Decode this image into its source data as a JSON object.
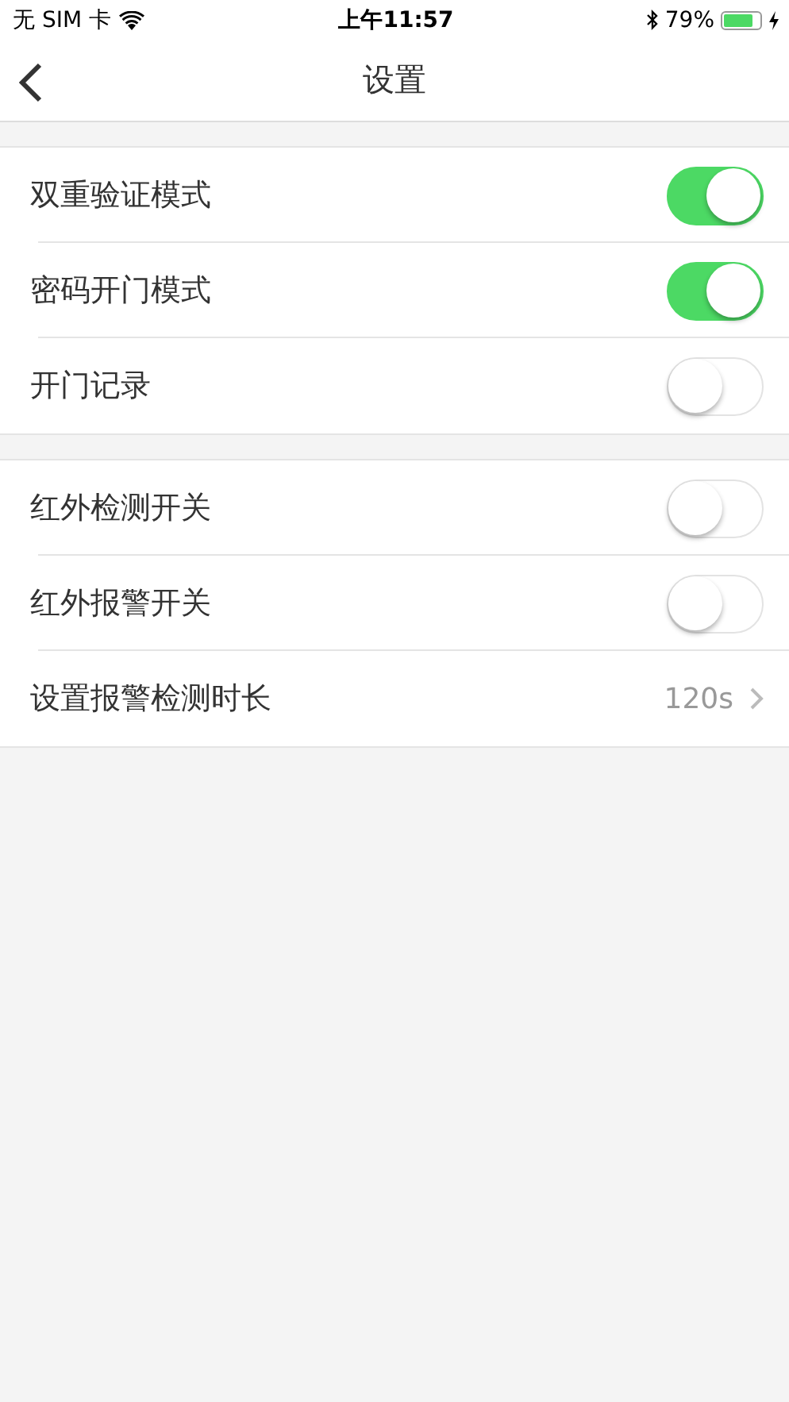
{
  "status_bar": {
    "carrier": "无 SIM 卡",
    "time": "上午11:57",
    "battery_text": "79%"
  },
  "nav_bar": {
    "title": "设置"
  },
  "groups": [
    {
      "rows": [
        {
          "kind": "toggle",
          "label": "双重验证模式",
          "on": true
        },
        {
          "kind": "toggle",
          "label": "密码开门模式",
          "on": true
        },
        {
          "kind": "toggle",
          "label": "开门记录",
          "on": false
        }
      ]
    },
    {
      "rows": [
        {
          "kind": "toggle",
          "label": "红外检测开关",
          "on": false
        },
        {
          "kind": "toggle",
          "label": "红外报警开关",
          "on": false
        },
        {
          "kind": "link",
          "label": "设置报警检测时长",
          "value": "120s"
        }
      ]
    }
  ]
}
